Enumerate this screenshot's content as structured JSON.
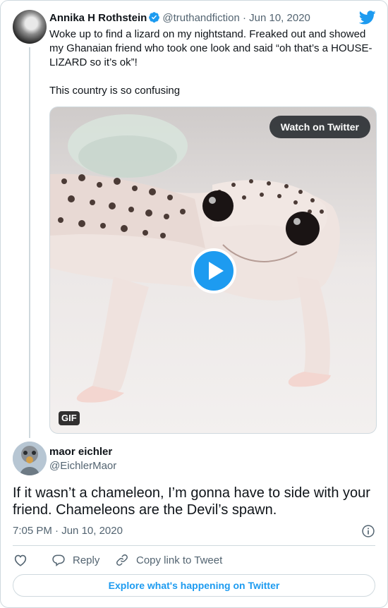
{
  "tweet": {
    "author_name": "Annika H Rothstein",
    "author_handle": "@truthandfiction",
    "separator": "·",
    "date": "Jun 10, 2020",
    "text_lines": [
      "Woke up to find a lizard on my nightstand. Freaked out and showed my Ghanaian friend who took one look and said “oh that’s a HOUSE-LIZARD so it’s ok”!",
      "This country is so confusing"
    ],
    "media": {
      "watch_label": "Watch on Twitter",
      "gif_label": "GIF"
    }
  },
  "reply": {
    "author_name": "maor eichler",
    "author_handle": "@EichlerMaor",
    "text": "If it wasn’t a chameleon, I’m gonna have to side with your friend. Chameleons are the Devil’s spawn.",
    "time": "7:05 PM",
    "separator": "·",
    "date": "Jun 10, 2020"
  },
  "actions": {
    "reply_label": "Reply",
    "copy_label": "Copy link to Tweet"
  },
  "footer": {
    "explore_label": "Explore what's happening on Twitter"
  },
  "icons": {
    "brand": "twitter-bird-icon",
    "verified": "verified-badge-icon",
    "info": "info-icon",
    "like": "heart-icon",
    "reply": "reply-bubble-icon",
    "copy": "link-icon",
    "play": "play-icon"
  },
  "colors": {
    "accent": "#1d9bf0",
    "text": "#0f1419",
    "muted": "#536471",
    "border": "#cfd9de"
  }
}
